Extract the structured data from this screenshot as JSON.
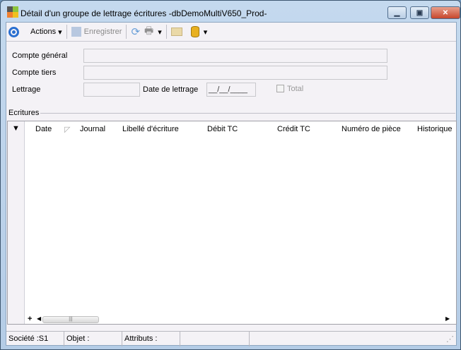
{
  "window": {
    "title": "Détail d'un groupe de lettrage écritures -dbDemoMultiV650_Prod-"
  },
  "toolbar": {
    "actions": "Actions",
    "save": "Enregistrer"
  },
  "form": {
    "compte_general_label": "Compte général",
    "compte_general_value": "",
    "compte_tiers_label": "Compte tiers",
    "compte_tiers_value": "",
    "lettrage_label": "Lettrage",
    "lettrage_value": "",
    "date_label": "Date de lettrage",
    "date_value": "__/__/____",
    "total_label": "Total",
    "total_checked": false
  },
  "grid": {
    "group_label": "Ecritures",
    "columns": [
      "Date",
      "Journal",
      "Libellé d'écriture",
      "Débit TC",
      "Crédit TC",
      "Numéro de pièce",
      "Historique"
    ],
    "rows": []
  },
  "statusbar": {
    "societe": "Société :S1",
    "objet": "Objet :",
    "attributs": "Attributs :"
  }
}
